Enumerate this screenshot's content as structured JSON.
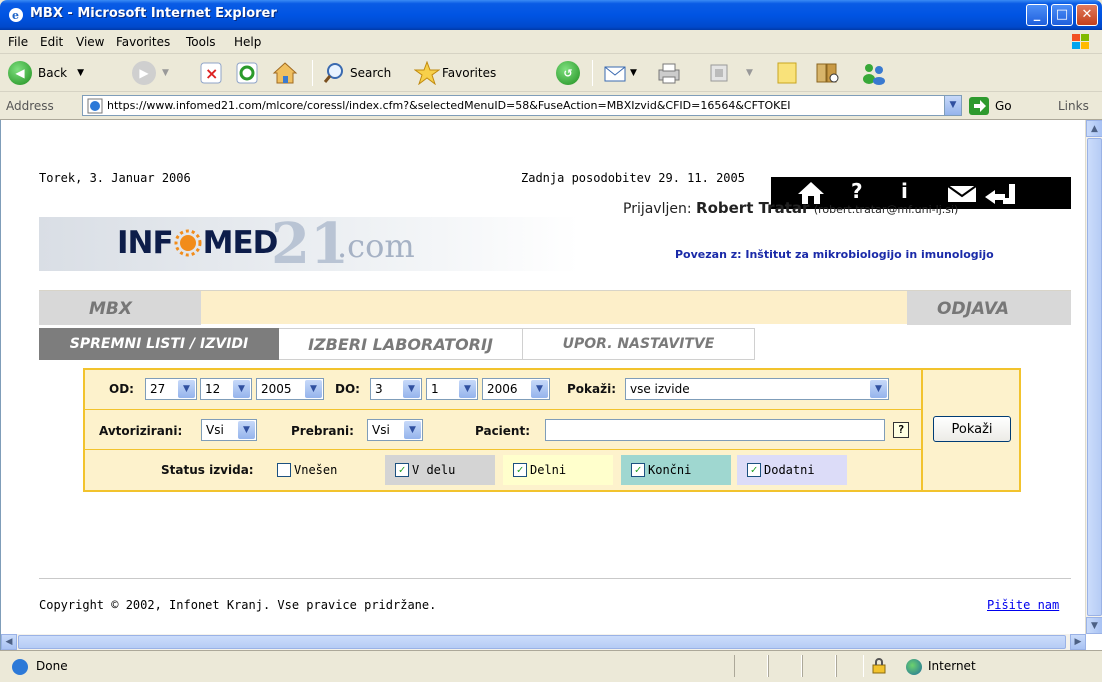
{
  "window": {
    "title": "MBX - Microsoft Internet Explorer"
  },
  "menu": [
    "File",
    "Edit",
    "View",
    "Favorites",
    "Tools",
    "Help"
  ],
  "toolbar": {
    "back": "Back",
    "search": "Search",
    "favorites": "Favorites"
  },
  "address": {
    "label": "Address",
    "url": "https://www.infomed21.com/mlcore/coressl/index.cfm?&selectedMenuID=58&FuseAction=MBXIzvid&CFID=16564&CFTOKEI",
    "go": "Go",
    "links": "Links"
  },
  "page": {
    "date": "Torek, 3. Januar 2006",
    "updated": "Zadnja posodobitev 29. 11. 2005",
    "logo": {
      "left": "INF",
      "right": "MED",
      "num": "21",
      "com": ".com"
    },
    "login": {
      "prefix": "Prijavljen:",
      "name": "Robert Tratar",
      "email": "(robert.tratar@mf.uni-lj.si)",
      "connected": "Povezan z: Inštitut za mikrobiologijo in imunologijo"
    },
    "menubar": {
      "left": "MBX",
      "right": "ODJAVA"
    },
    "tabs": [
      "SPREMNI LISTI / IZVIDI",
      "IZBERI LABORATORIJ",
      "UPOR. NASTAVITVE"
    ],
    "form": {
      "od_label": "OD:",
      "od_day": "27",
      "od_month": "12",
      "od_year": "2005",
      "do_label": "DO:",
      "do_day": "3",
      "do_month": "1",
      "do_year": "2006",
      "pokazi_label": "Pokaži:",
      "pokazi_value": "vse izvide",
      "avtorizirani_label": "Avtorizirani:",
      "avtorizirani_value": "Vsi",
      "prebrani_label": "Prebrani:",
      "prebrani_value": "Vsi",
      "pacient_label": "Pacient:",
      "pacient_value": "",
      "submit": "Pokaži",
      "status_label": "Status izvida:",
      "statuses": [
        {
          "label": "Vnešen",
          "checked": false,
          "color": "#ffffff"
        },
        {
          "label": "V delu",
          "checked": true,
          "color": "#d4d4d4"
        },
        {
          "label": "Delni",
          "checked": true,
          "color": "#ffffcc"
        },
        {
          "label": "Končni",
          "checked": true,
          "color": "#9fd7d0"
        },
        {
          "label": "Dodatni",
          "checked": true,
          "color": "#dcdcf8"
        }
      ]
    },
    "copyright": "Copyright © 2002, Infonet Kranj. Vse pravice pridržane.",
    "write_us": "Pišite nam"
  },
  "statusbar": {
    "status": "Done",
    "zone": "Internet"
  }
}
